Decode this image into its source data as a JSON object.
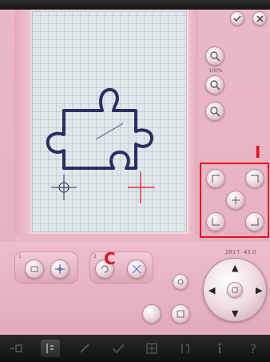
{
  "annotations": {
    "label_i": "I",
    "label_c": "C"
  },
  "zoom": {
    "percent": "100%"
  },
  "position": {
    "coords": "281↑  43.0"
  },
  "tools": {
    "tool1_number": "1",
    "tool2_number": "2"
  },
  "colors": {
    "accent_annotation": "#e8111f",
    "panel_pink": "#e7b3c3",
    "taskbar": "#151515",
    "puzzle_outline": "#2c2c62"
  },
  "icons": {
    "confirm": "check-icon",
    "cancel": "close-icon",
    "zoom_in": "zoom-in-icon",
    "zoom_percent": "zoom-fit-icon",
    "zoom_out": "zoom-out-icon"
  }
}
